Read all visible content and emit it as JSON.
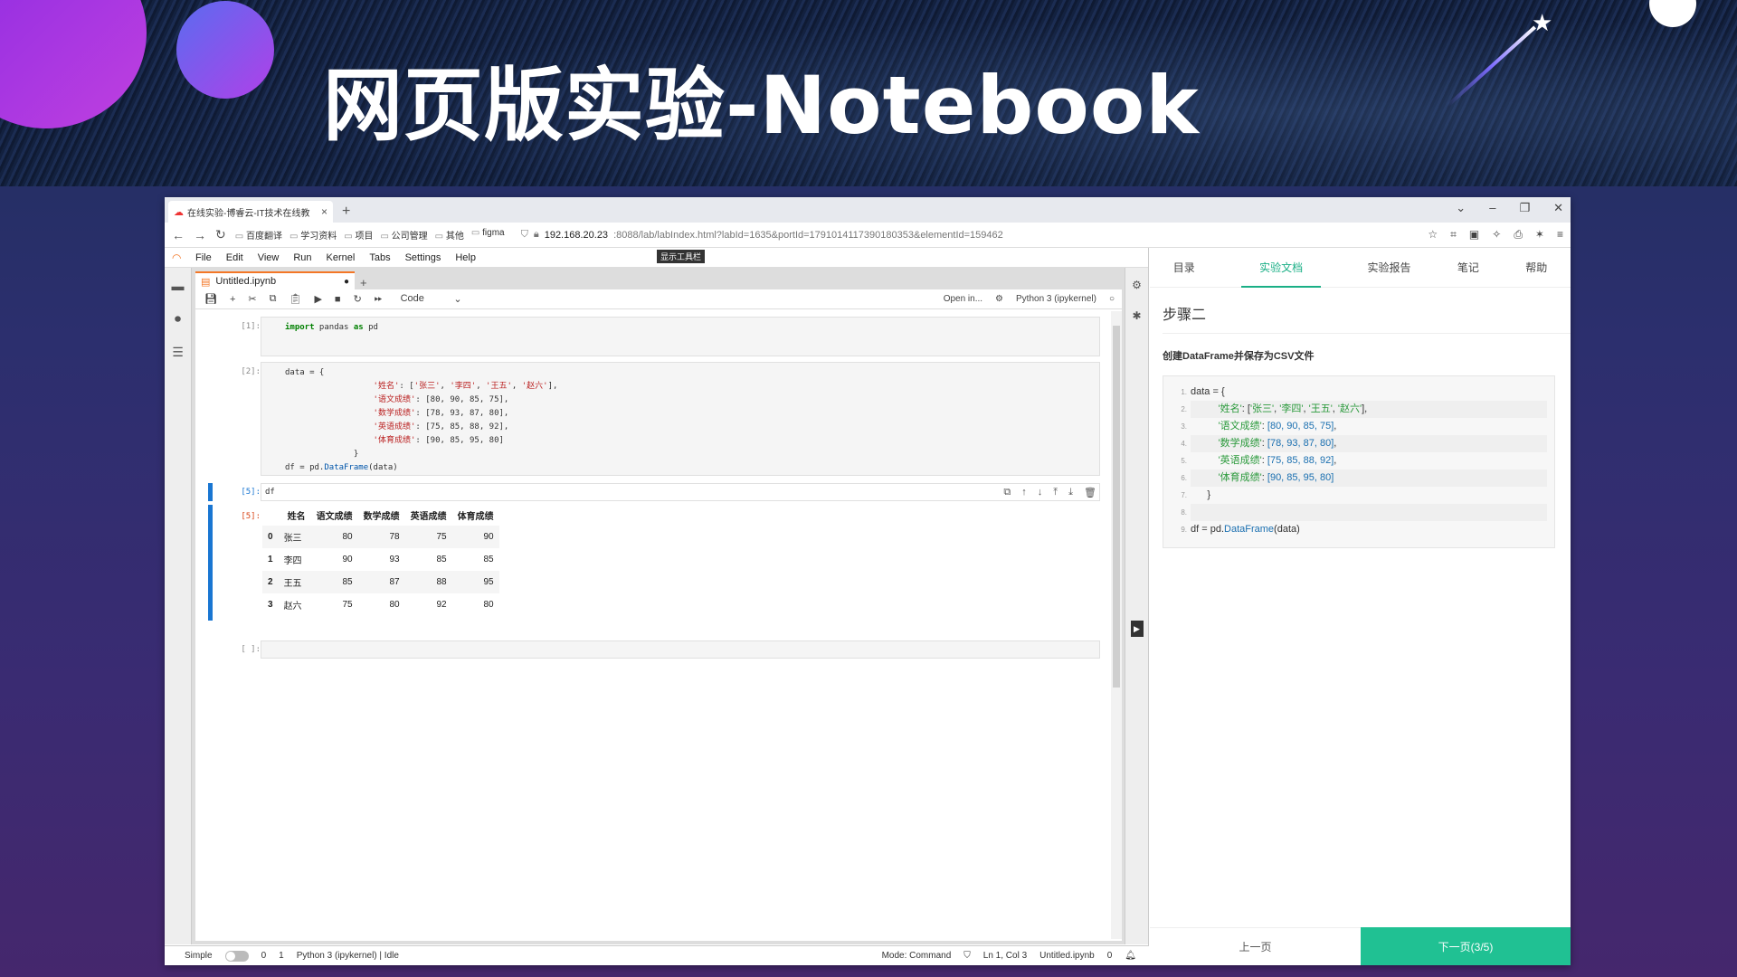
{
  "slide": {
    "title": "网页版实验-Notebook"
  },
  "browser": {
    "tab_title": "在线实验-博睿云-IT技术在线教",
    "url_host": "192.168.20.23",
    "url_rest": ":8088/lab/labIndex.html?labId=1635&portId=1791014117390180353&elementId=159462",
    "bookmarks": [
      "百度翻译",
      "学习资料",
      "项目",
      "公司管理",
      "其他",
      "figma"
    ]
  },
  "jupyter": {
    "menu": [
      "File",
      "Edit",
      "View",
      "Run",
      "Kernel",
      "Tabs",
      "Settings",
      "Help"
    ],
    "tooltip": "显示工具栏",
    "doc_tab": "Untitled.ipynb",
    "cell_type": "Code",
    "open_in": "Open in...",
    "kernel": "Python 3 (ipykernel)",
    "cells": [
      {
        "prompt": "[1]:",
        "code": "import pandas as pd"
      },
      {
        "prompt": "[2]:",
        "code": "data"
      },
      {
        "prompt": "[5]:",
        "code": "df"
      }
    ],
    "output": {
      "prompt": "[5]:",
      "columns": [
        "",
        "姓名",
        "语文成绩",
        "数学成绩",
        "英语成绩",
        "体育成绩"
      ],
      "rows": [
        [
          "0",
          "张三",
          "80",
          "78",
          "75",
          "90"
        ],
        [
          "1",
          "李四",
          "90",
          "93",
          "85",
          "85"
        ],
        [
          "2",
          "王五",
          "85",
          "87",
          "88",
          "95"
        ],
        [
          "3",
          "赵六",
          "75",
          "80",
          "92",
          "80"
        ]
      ]
    },
    "empty_prompt": "[ ]:",
    "status": {
      "mode": "Simple",
      "n1": "0",
      "n2": "1",
      "kernel_status": "Python 3 (ipykernel) | Idle",
      "cmd": "Mode: Command",
      "pos": "Ln 1, Col 3",
      "file": "Untitled.ipynb",
      "n3": "0"
    }
  },
  "panel": {
    "tabs": [
      "目录",
      "实验文档",
      "实验报告",
      "笔记",
      "帮助"
    ],
    "step": "步骤二",
    "desc": "创建DataFrame并保存为CSV文件",
    "prev": "上一页",
    "next": "下一页(3/5)"
  }
}
